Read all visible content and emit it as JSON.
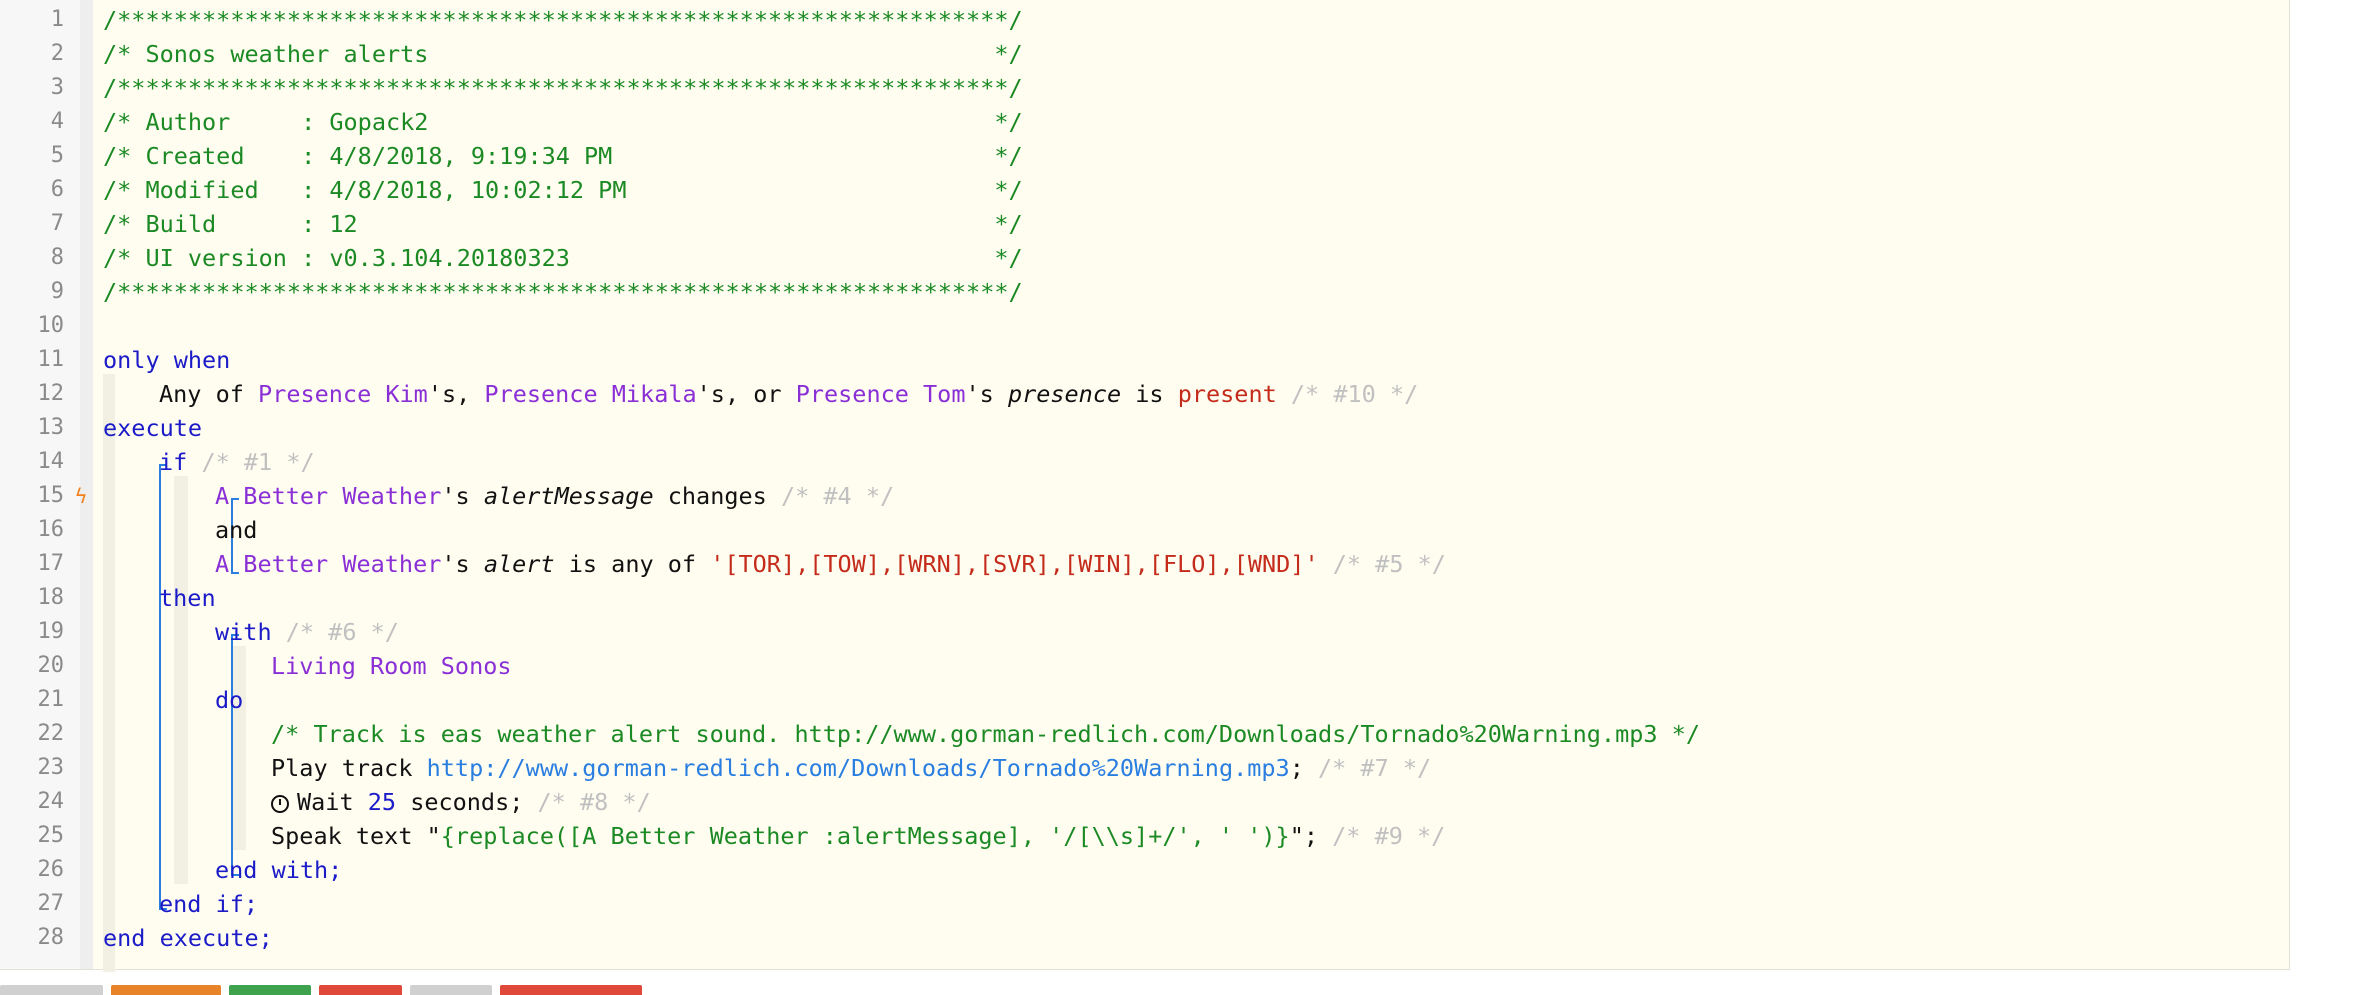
{
  "editor": {
    "lines": [
      {
        "n": "1",
        "parts": [
          {
            "t": "/***************************************************************/",
            "c": "green"
          }
        ]
      },
      {
        "n": "2",
        "parts": [
          {
            "t": "/* Sonos weather alerts                                        */",
            "c": "green"
          }
        ]
      },
      {
        "n": "3",
        "parts": [
          {
            "t": "/***************************************************************/",
            "c": "green"
          }
        ]
      },
      {
        "n": "4",
        "parts": [
          {
            "t": "/* Author     : Gopack2                                        */",
            "c": "green"
          }
        ]
      },
      {
        "n": "5",
        "parts": [
          {
            "t": "/* Created    : 4/8/2018, 9:19:34 PM                           */",
            "c": "green"
          }
        ]
      },
      {
        "n": "6",
        "parts": [
          {
            "t": "/* Modified   : 4/8/2018, 10:02:12 PM                          */",
            "c": "green"
          }
        ]
      },
      {
        "n": "7",
        "parts": [
          {
            "t": "/* Build      : 12                                             */",
            "c": "green"
          }
        ]
      },
      {
        "n": "8",
        "parts": [
          {
            "t": "/* UI version : v0.3.104.20180323                              */",
            "c": "green"
          }
        ]
      },
      {
        "n": "9",
        "parts": [
          {
            "t": "/***************************************************************/",
            "c": "green"
          }
        ]
      },
      {
        "n": "10",
        "parts": []
      },
      {
        "n": "11",
        "parts": [
          {
            "t": "only when",
            "c": "kw"
          }
        ]
      },
      {
        "n": "12",
        "indent": 1,
        "parts": [
          {
            "t": "Any of ",
            "c": "txt"
          },
          {
            "t": "Presence Kim",
            "c": "dev"
          },
          {
            "t": "'s, ",
            "c": "txt"
          },
          {
            "t": "Presence Mikala",
            "c": "dev"
          },
          {
            "t": "'s, or ",
            "c": "txt"
          },
          {
            "t": "Presence Tom",
            "c": "dev"
          },
          {
            "t": "'s ",
            "c": "txt"
          },
          {
            "t": "presence",
            "c": "txt",
            "i": true
          },
          {
            "t": " is ",
            "c": "txt"
          },
          {
            "t": "present",
            "c": "str"
          },
          {
            "t": " /* #10 */",
            "c": "gray"
          }
        ]
      },
      {
        "n": "13",
        "parts": [
          {
            "t": "execute",
            "c": "kw"
          }
        ]
      },
      {
        "n": "14",
        "indent": 1,
        "parts": [
          {
            "t": "if",
            "c": "kw"
          },
          {
            "t": " /* #1 */",
            "c": "gray"
          }
        ]
      },
      {
        "n": "15",
        "indent": 2,
        "bolt": "ϟ",
        "parts": [
          {
            "t": "A Better Weather",
            "c": "dev"
          },
          {
            "t": "'s ",
            "c": "txt"
          },
          {
            "t": "alertMessage",
            "c": "txt",
            "i": true
          },
          {
            "t": " changes",
            "c": "txt"
          },
          {
            "t": " /* #4 */",
            "c": "gray"
          }
        ]
      },
      {
        "n": "16",
        "indent": 2,
        "parts": [
          {
            "t": "and",
            "c": "txt"
          }
        ]
      },
      {
        "n": "17",
        "indent": 2,
        "parts": [
          {
            "t": "A Better Weather",
            "c": "dev"
          },
          {
            "t": "'s ",
            "c": "txt"
          },
          {
            "t": "alert",
            "c": "txt",
            "i": true
          },
          {
            "t": " is any of ",
            "c": "txt"
          },
          {
            "t": "'[TOR],[TOW],[WRN],[SVR],[WIN],[FLO],[WND]'",
            "c": "str"
          },
          {
            "t": " /* #5 */",
            "c": "gray"
          }
        ]
      },
      {
        "n": "18",
        "indent": 1,
        "parts": [
          {
            "t": "then",
            "c": "kw"
          }
        ]
      },
      {
        "n": "19",
        "indent": 2,
        "parts": [
          {
            "t": "with",
            "c": "kw"
          },
          {
            "t": " /* #6 */",
            "c": "gray"
          }
        ]
      },
      {
        "n": "20",
        "indent": 3,
        "parts": [
          {
            "t": "Living Room Sonos",
            "c": "dev"
          }
        ]
      },
      {
        "n": "21",
        "indent": 2,
        "parts": [
          {
            "t": "do",
            "c": "kw"
          }
        ]
      },
      {
        "n": "22",
        "indent": 3,
        "parts": [
          {
            "t": "/* Track is eas weather alert sound. http://www.gorman-redlich.com/Downloads/Tornado%20Warning.mp3 */",
            "c": "green"
          }
        ]
      },
      {
        "n": "23",
        "indent": 3,
        "parts": [
          {
            "t": "Play track ",
            "c": "txt"
          },
          {
            "t": "http://www.gorman-redlich.com/Downloads/Tornado%20Warning.mp3",
            "c": "url"
          },
          {
            "t": ";",
            "c": "txt"
          },
          {
            "t": " /* #7 */",
            "c": "gray"
          }
        ]
      },
      {
        "n": "24",
        "indent": 3,
        "clock": true,
        "parts": [
          {
            "t": "Wait ",
            "c": "txt"
          },
          {
            "t": "25",
            "c": "num"
          },
          {
            "t": " seconds;",
            "c": "txt"
          },
          {
            "t": " /* #8 */",
            "c": "gray"
          }
        ]
      },
      {
        "n": "25",
        "indent": 3,
        "parts": [
          {
            "t": "Speak text \"",
            "c": "txt"
          },
          {
            "t": "{replace([A Better Weather :alertMessage], '/[\\\\s]+/', ' ')}",
            "c": "expr"
          },
          {
            "t": "\";",
            "c": "txt"
          },
          {
            "t": " /* #9 */",
            "c": "gray"
          }
        ]
      },
      {
        "n": "26",
        "indent": 2,
        "parts": [
          {
            "t": "end with;",
            "c": "kw"
          }
        ]
      },
      {
        "n": "27",
        "indent": 1,
        "parts": [
          {
            "t": "end if;",
            "c": "kw"
          }
        ]
      },
      {
        "n": "28",
        "parts": [
          {
            "t": "end execute;",
            "c": "kw"
          }
        ]
      }
    ]
  },
  "tabs": [
    {
      "color": "#d0d0d0"
    },
    {
      "color": "#e8832a"
    },
    {
      "color": "#3fa34d"
    },
    {
      "color": "#e0483a"
    },
    {
      "color": "#d0d0d0"
    },
    {
      "color": "#e0483a"
    }
  ]
}
